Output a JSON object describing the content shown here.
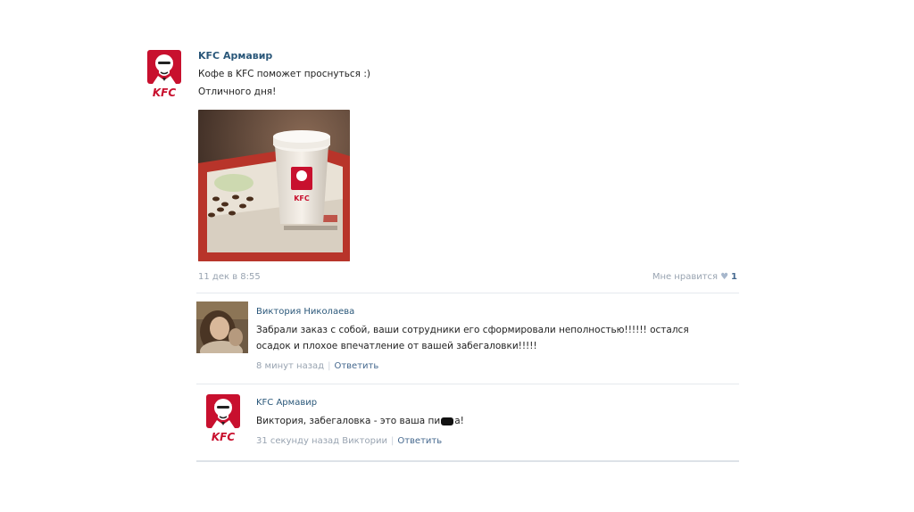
{
  "post": {
    "author": "KFC Армавир",
    "text_line1": "Кофе в KFC поможет проснуться :)",
    "text_line2": "Отличного дня!",
    "date": "11 дек в 8:55",
    "likes_label": "Мне нравится",
    "likes_count": "1"
  },
  "comments": [
    {
      "author": "Виктория Николаева",
      "text_line1": "Забрали заказ с собой, ваши сотрудники его сформировали неполностью!!!!!! остался",
      "text_line2": "осадок и плохое впечатление от вашей забегаловки!!!!!",
      "time": "8 минут назад",
      "reply": "Ответить"
    },
    {
      "author": "KFC Армавир",
      "text_before": "Виктория, забегаловка - это ваша пи",
      "text_after": "а!",
      "time": "31 секунду назад Виктории",
      "reply": "Ответить"
    }
  ],
  "colors": {
    "link": "#2b587a",
    "meta": "#99a4b1",
    "kfc_red": "#c8102e"
  },
  "icons": {
    "like": "heart-icon"
  }
}
